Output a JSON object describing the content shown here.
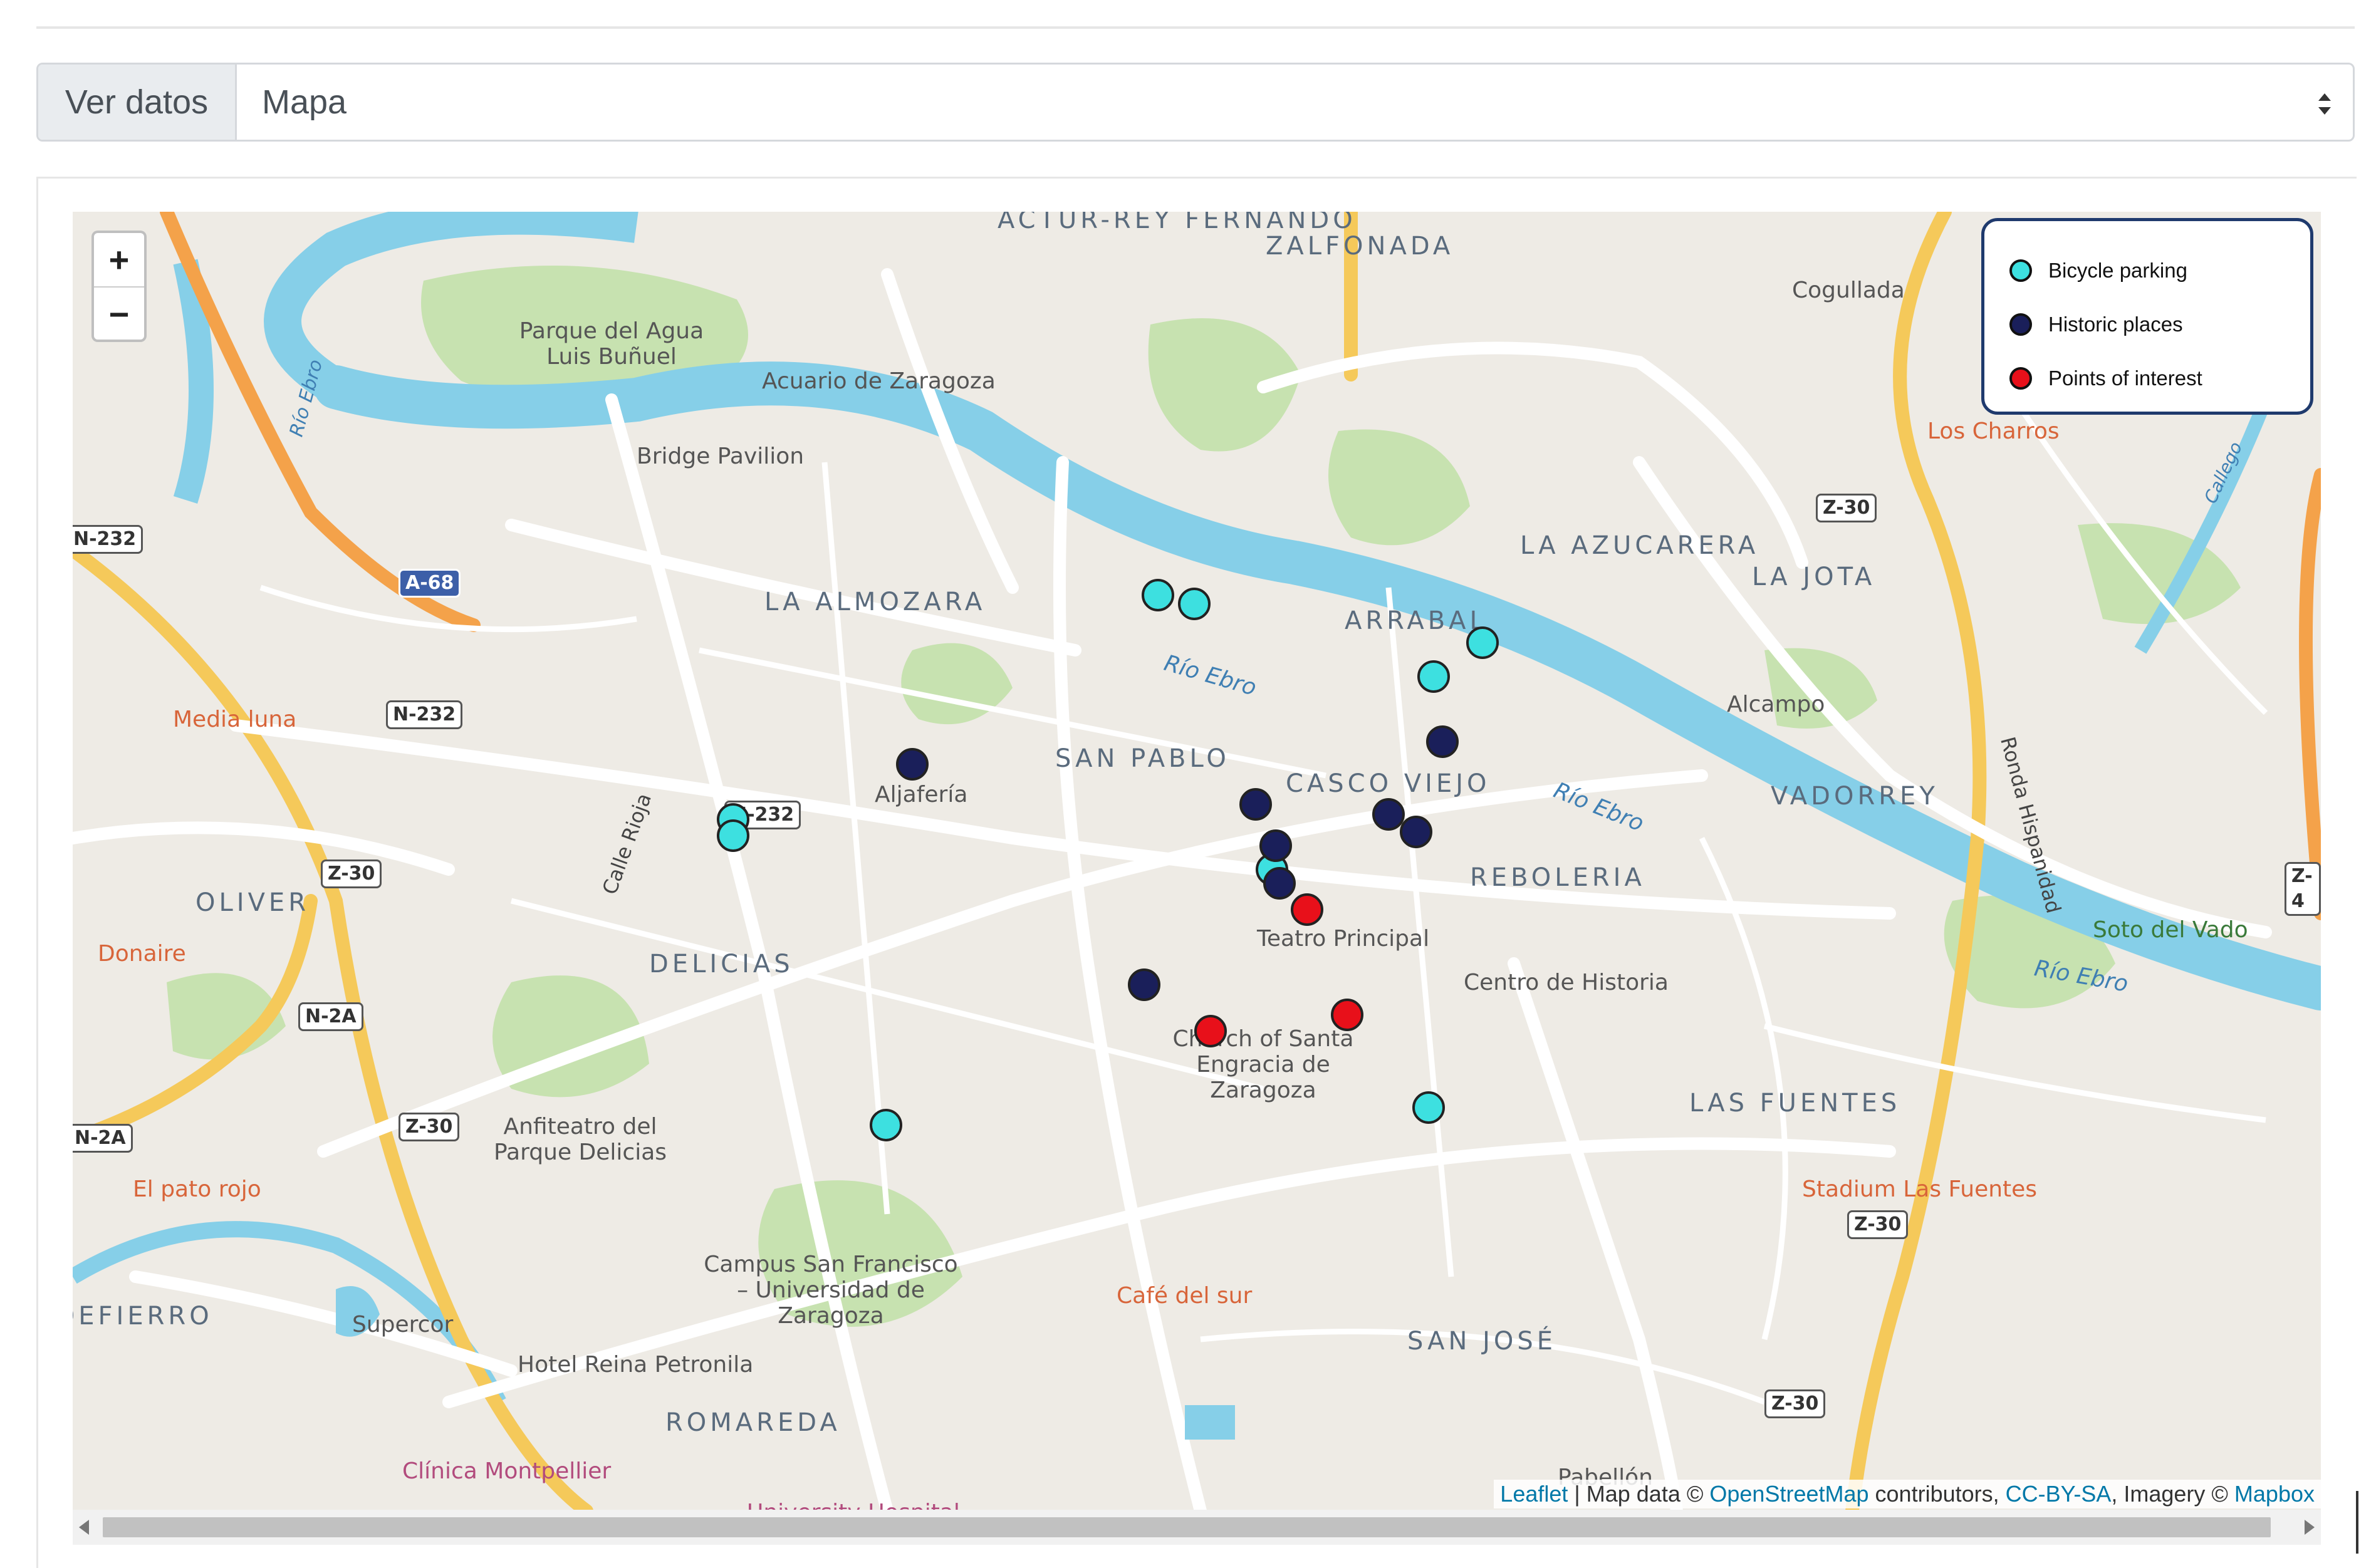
{
  "view_selector": {
    "label": "Ver datos",
    "selected": "Mapa"
  },
  "map": {
    "zoom_in": "+",
    "zoom_out": "−",
    "legend": [
      {
        "label": "Bicycle parking",
        "color": "#3de0e0"
      },
      {
        "label": "Historic places",
        "color": "#1a1f5a"
      },
      {
        "label": "Points of interest",
        "color": "#e8101a"
      }
    ],
    "attribution": {
      "leaflet": "Leaflet",
      "sep1": " | Map data © ",
      "osm": "OpenStreetMap",
      "sep2": " contributors, ",
      "license": "CC-BY-SA",
      "sep3": ", Imagery © ",
      "imagery": "Mapbox"
    },
    "districts": [
      "ACTUR-REY FERNANDO",
      "ZALFONADA",
      "LA ALMOZARA",
      "ARRABAL",
      "LA AZUCARERA",
      "LA JOTA",
      "SAN PABLO",
      "CASCO VIEJO",
      "VADORREY",
      "REBOLERIA",
      "OLIVER",
      "DELICIAS",
      "LAS FUENTES",
      "SAN JOSÉ",
      "ROMAREDA",
      "VALDEFIERRO"
    ],
    "places": [
      "Parque del Agua Luis Buñuel",
      "Acuario de Zaragoza",
      "Bridge Pavilion",
      "Aljafería",
      "Teatro Principal",
      "Centro de Historia",
      "Church of Santa Engracia de Zaragoza",
      "Anfiteatro del Parque Delicias",
      "Campus San Francisco – Universidad de Zaragoza",
      "Hotel Reina Petronila",
      "Supercor",
      "Clínica Montpellier",
      "University Hospital",
      "Cogullada",
      "Alcampo",
      "Soto del Vado",
      "Pabellón"
    ],
    "food_places": [
      "Media luna",
      "Donaire",
      "El pato rojo",
      "Los Charros",
      "Café del sur",
      "Stadium Las Fuentes"
    ],
    "rivers": [
      "Río Ebro",
      "Río Ebro",
      "Río Ebro",
      "Río Ebro",
      "Calle Rioja",
      "Ronda Hispanidad",
      "Callego"
    ],
    "roads": [
      "N-232",
      "N-232",
      "N-2A",
      "N-2A",
      "Z-30",
      "Z-30",
      "Z-30",
      "Z-30",
      "Z-30",
      "A-68",
      "N-232",
      "Z-4"
    ]
  }
}
